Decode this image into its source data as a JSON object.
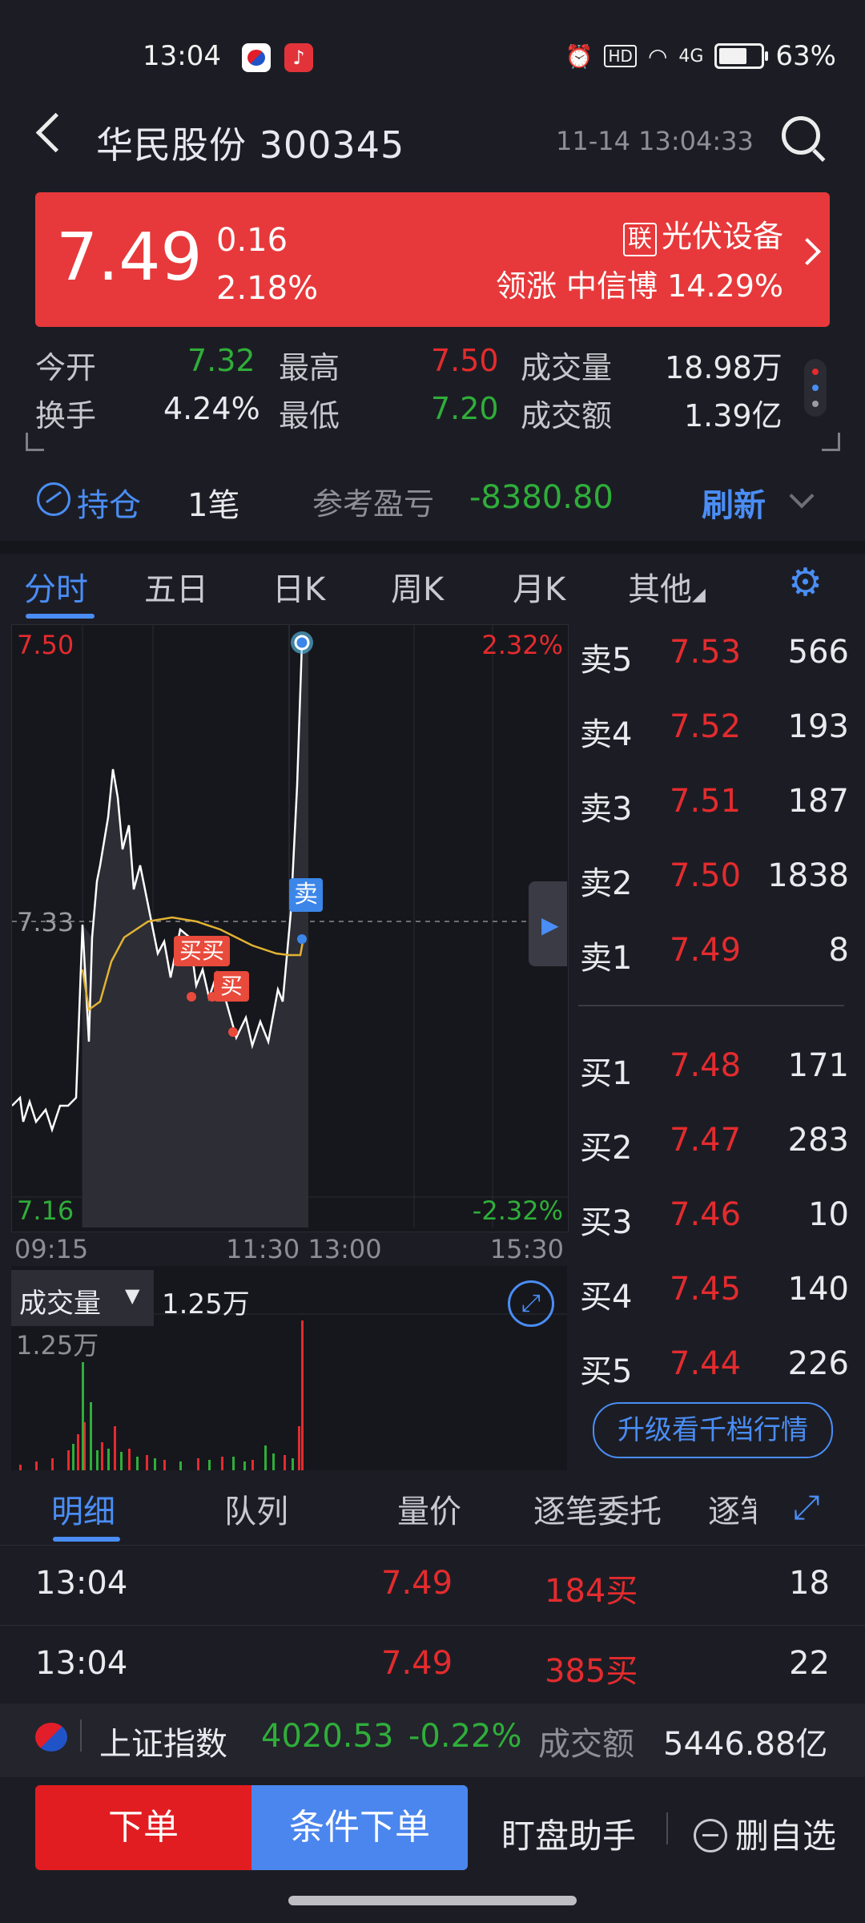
{
  "status_bar": {
    "time": "13:04",
    "battery": "63%",
    "network": "4G"
  },
  "header": {
    "title": "华民股份 300345",
    "datetime": "11-14 13:04:33"
  },
  "quote": {
    "price": "7.49",
    "change": "0.16",
    "change_pct": "2.18%",
    "sector_tag": "联",
    "sector": "光伏设备",
    "leader": "领涨 中信博 14.29%"
  },
  "stats": {
    "open_label": "今开",
    "open": "7.32",
    "high_label": "最高",
    "high": "7.50",
    "volume_label": "成交量",
    "volume": "18.98万",
    "turnover_label": "换手",
    "turnover": "4.24%",
    "low_label": "最低",
    "low": "7.20",
    "amount_label": "成交额",
    "amount": "1.39亿"
  },
  "position": {
    "label": "持仓",
    "count": "1笔",
    "pl_label": "参考盈亏",
    "pl_value": "-8380.80",
    "refresh": "刷新"
  },
  "chart_tabs": [
    "分时",
    "五日",
    "日K",
    "周K",
    "月K",
    "其他"
  ],
  "chart": {
    "y_top": "7.50",
    "y_mid": "7.33",
    "y_bottom": "7.16",
    "pct_top": "2.32%",
    "pct_bottom": "-2.32%",
    "x_labels": [
      "09:15",
      "11:30 13:00",
      "15:30"
    ],
    "sell_marker": "卖",
    "buy_marker_1": "买买",
    "buy_marker_2": "买",
    "volume_label": "成交量",
    "volume_value": "1.25万",
    "volume_axis": "1.25万"
  },
  "order_book": {
    "asks": [
      {
        "label": "卖5",
        "price": "7.53",
        "qty": "566"
      },
      {
        "label": "卖4",
        "price": "7.52",
        "qty": "193"
      },
      {
        "label": "卖3",
        "price": "7.51",
        "qty": "187"
      },
      {
        "label": "卖2",
        "price": "7.50",
        "qty": "1838"
      },
      {
        "label": "卖1",
        "price": "7.49",
        "qty": "8"
      }
    ],
    "bids": [
      {
        "label": "买1",
        "price": "7.48",
        "qty": "171"
      },
      {
        "label": "买2",
        "price": "7.47",
        "qty": "283"
      },
      {
        "label": "买3",
        "price": "7.46",
        "qty": "10"
      },
      {
        "label": "买4",
        "price": "7.45",
        "qty": "140"
      },
      {
        "label": "买5",
        "price": "7.44",
        "qty": "226"
      }
    ],
    "upgrade": "升级看千档行情"
  },
  "detail_tabs": [
    "明细",
    "队列",
    "量价",
    "逐笔委托",
    "逐笔"
  ],
  "trades": [
    {
      "time": "13:04",
      "price": "7.49",
      "vol": "184买",
      "count": "18"
    },
    {
      "time": "13:04",
      "price": "7.49",
      "vol": "385买",
      "count": "22"
    }
  ],
  "index": {
    "name": "上证指数",
    "value": "4020.53",
    "change": "-0.22%",
    "amount_label": "成交额",
    "amount": "5446.88亿"
  },
  "actions": {
    "order": "下单",
    "conditional": "条件下单",
    "watch": "盯盘助手",
    "remove": "删自选"
  },
  "colors": {
    "up": "#e42b2e",
    "down": "#2fae3a",
    "accent": "#4a8df5",
    "banner": "#e7393b"
  }
}
